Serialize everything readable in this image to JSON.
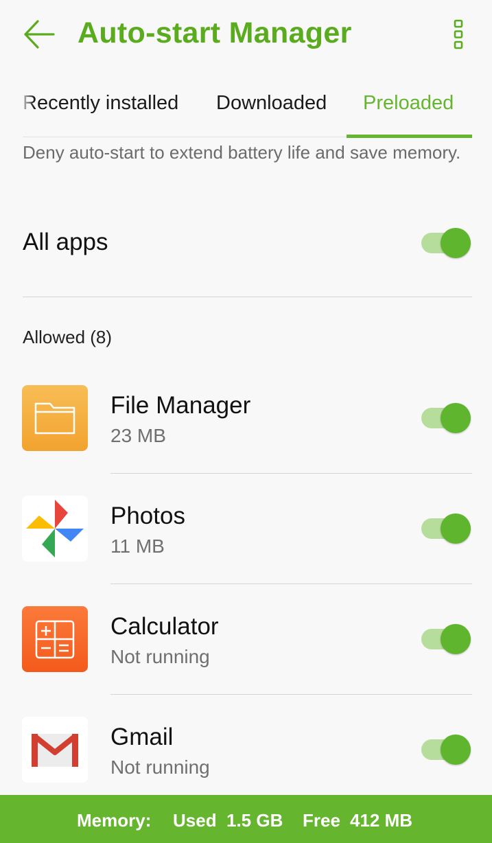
{
  "header": {
    "title": "Auto-start Manager",
    "back_icon": "arrow-left-icon",
    "menu_icon": "more-vert-icon",
    "accent_color": "#5bab1e"
  },
  "tabs": [
    {
      "label": "Recently installed",
      "selected": false
    },
    {
      "label": "Downloaded",
      "selected": false
    },
    {
      "label": "Preloaded",
      "selected": true
    }
  ],
  "description": "Deny auto-start to extend battery life and save memory.",
  "all_apps": {
    "label": "All apps",
    "enabled": true
  },
  "allowed_section": {
    "label": "Allowed (8)"
  },
  "apps": [
    {
      "name": "File Manager",
      "detail": "23 MB",
      "icon": "file-manager-icon",
      "enabled": true
    },
    {
      "name": "Photos",
      "detail": "11 MB",
      "icon": "photos-icon",
      "enabled": true
    },
    {
      "name": "Calculator",
      "detail": "Not running",
      "icon": "calculator-icon",
      "enabled": true
    },
    {
      "name": "Gmail",
      "detail": "Not running",
      "icon": "gmail-icon",
      "enabled": true
    }
  ],
  "memory_bar": {
    "label": "Memory:",
    "used_label": "Used",
    "used_value": "1.5 GB",
    "free_label": "Free",
    "free_value": "412 MB",
    "color": "#66b52e"
  }
}
